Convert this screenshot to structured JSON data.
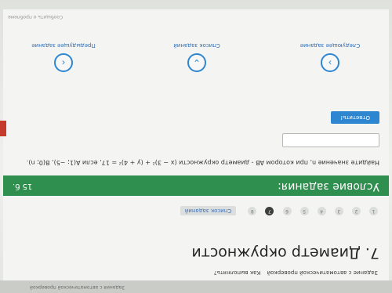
{
  "topbar": {
    "right_text": "Задания с автоматической проверкой"
  },
  "breadcrumbs": {
    "section": "Задание с автоматической проверкой",
    "help": "Как выполнять?"
  },
  "title": "7. Диаметр окружности",
  "pager": {
    "pages": [
      "1",
      "2",
      "3",
      "4",
      "5",
      "6",
      "7",
      "8"
    ],
    "active": "7",
    "list_link": "Список заданий"
  },
  "task": {
    "header": "Условие задания:",
    "number": "15 б."
  },
  "question": "Найдите значение n, при котором AB - диаметр окружности (x − 3)² + (y + 4)² = 17, если A(1; −5), B(0; n).",
  "answer": {
    "value": ""
  },
  "submit_label": "Ответить!",
  "nav": {
    "prev": {
      "label": "Предыдущее задание",
      "icon": "chevron-left-icon"
    },
    "list": {
      "label": "Список заданий",
      "icon": "chevron-down-icon"
    },
    "next": {
      "label": "Следующее задание",
      "icon": "chevron-right-icon"
    }
  },
  "footer_hint": "Сообщить о проблеме",
  "colors": {
    "header": "#2f8f4e",
    "accent": "#2e86d1",
    "alert": "#c43a2b"
  }
}
